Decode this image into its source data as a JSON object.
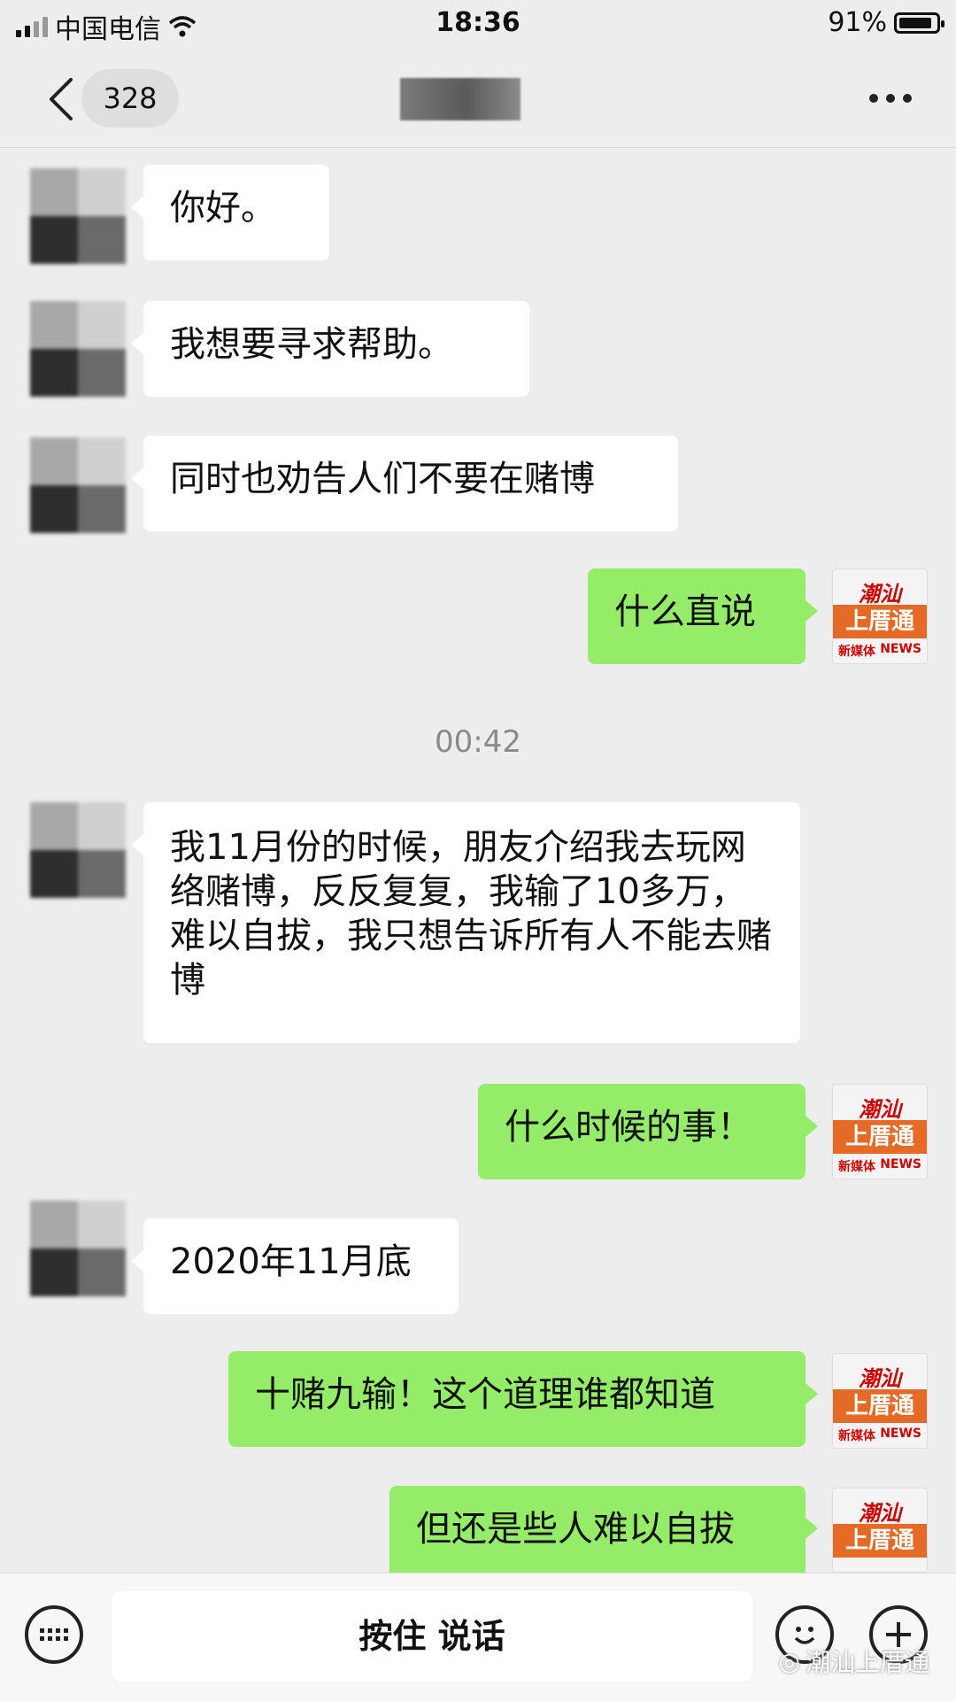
{
  "status_bar": {
    "carrier": "中国电信",
    "time": "18:36",
    "battery": "91%",
    "battery_level": 0.91
  },
  "nav": {
    "unread_count": "328"
  },
  "timestamp": "00:42",
  "messages": [
    {
      "side": "in",
      "text": "你好。"
    },
    {
      "side": "in",
      "text": "我想要寻求帮助。"
    },
    {
      "side": "in",
      "text": "同时也劝告人们不要在赌博"
    },
    {
      "side": "out",
      "text": "什么直说"
    },
    {
      "side": "in",
      "text": "我11月份的时候，朋友介绍我去玩网络赌博，反反复复，我输了10多万，难以自拔，我只想告诉所有人不能去赌博"
    },
    {
      "side": "out",
      "text": "什么时候的事！"
    },
    {
      "side": "in",
      "text": "2020年11月底"
    },
    {
      "side": "out",
      "text": "十赌九输！这个道理谁都知道"
    },
    {
      "side": "out",
      "text": "但还是些人难以自拔"
    }
  ],
  "logo": {
    "top": "潮汕",
    "middle": "上厝通",
    "bottom_left": "新媒体",
    "bottom_right": "NEWS"
  },
  "input_bar": {
    "talk_label": "按住 说话"
  },
  "watermark": "潮汕上厝通"
}
